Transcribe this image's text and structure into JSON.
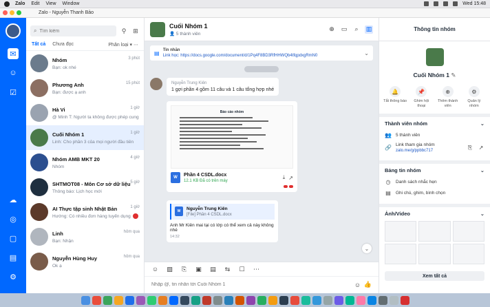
{
  "menubar": {
    "items": [
      "Zalo",
      "Edit",
      "View",
      "Window"
    ],
    "clock": "Wed 15:48"
  },
  "window": {
    "title": "Zalo - Nguyễn Thanh Bảo"
  },
  "conversation_list": {
    "search_placeholder": "Tìm kiếm",
    "tabs": [
      "Tất cả",
      "Chưa đọc"
    ],
    "filter_label": "Phân loại",
    "items": [
      {
        "name": "Nhóm",
        "preview": "Bạn: ok nhé",
        "time": "3 phút",
        "avatar_color": "#6b7b8c"
      },
      {
        "name": "Phương Anh",
        "preview": "Bạn: được ạ anh",
        "time": "15 phút",
        "avatar_color": "#8c6f62"
      },
      {
        "name": "Hà Vi",
        "preview": "@ Minh T: Người ta không được phép cung cấp",
        "time": "1 giờ",
        "avatar_color": "#9aa3b0"
      },
      {
        "name": "Cuối Nhóm 1",
        "preview": "Linh: Cho phần 3 của mọi người đầu tiên",
        "time": "1 giờ",
        "avatar_color": "#4a7a4a",
        "selected": true
      },
      {
        "name": "Nhóm AMB MKT 20",
        "preview": "Nhóm",
        "time": "4 giờ",
        "avatar_color": "#2c4f8f"
      },
      {
        "name": "SHTMOT08 - Môn Cơ sở dữ liệu",
        "preview": "Thông báo: Lịch học mới",
        "time": "5 giờ",
        "avatar_color": "#1f2f3f"
      },
      {
        "name": "AI Thực tập sinh Nhật Bản",
        "preview": "Hướng: Có nhiều đơn hàng tuyển dụng",
        "time": "1 giờ",
        "avatar_color": "#5c3a2a",
        "badge": true
      },
      {
        "name": "Linh",
        "preview": "Bạn: Nhận",
        "time": "hôm qua",
        "avatar_color": "#b0b6be"
      },
      {
        "name": "Nguyễn Hùng Huy",
        "preview": "Ok ạ",
        "time": "hôm qua",
        "avatar_color": "#7a5c4a"
      }
    ]
  },
  "chat": {
    "group_name": "Cuối Nhóm 1",
    "member_count": "5 thành viên",
    "pinned_title": "Tin nhắn",
    "pinned_link": "Link học: https://docs.google.com/document/d/1Pq4F8BD3RfHHWQb4tfqpdxgRmN0",
    "message_sender": "Nguyễn Trung Kiên",
    "message_text": "1 gợi phần 4 gồm 11 câu và 1 câu tổng hợp nhé",
    "doc_title": "Báo cáo nhóm",
    "doc_file_name": "Phần 4 CSDL.docx",
    "doc_file_size": "12.1 KB  Đã có trên máy",
    "reply_quote_name": "Nguyễn Trung Kiên",
    "reply_quote_file": "[File] Phần 4 CSDL.docx",
    "reply_text": "Anh Mr Kiên mai tại có lớp có thể xem cả này không nhé",
    "reply_time": "14:32",
    "composer_placeholder": "Nhập @, tin nhắn tới Cuối Nhóm 1"
  },
  "info_panel": {
    "title": "Thông tin nhóm",
    "group_name": "Cuối Nhóm 1",
    "actions": [
      {
        "label": "Tắt thông báo",
        "icon": "bell-icon"
      },
      {
        "label": "Ghim hội thoại",
        "icon": "pin-icon"
      },
      {
        "label": "Thêm thành viên",
        "icon": "add-user-icon"
      },
      {
        "label": "Quản lý nhóm",
        "icon": "gear-icon"
      }
    ],
    "members_section": "Thành viên nhóm",
    "members_count": "5 thành viên",
    "invite_link_label": "Link tham gia nhóm",
    "invite_link": "zalo.me/g/ppbbc717",
    "board_section": "Bảng tin nhóm",
    "board_items": [
      "Danh sách nhắc hẹn",
      "Ghi chú, ghim, bình chọn"
    ],
    "media_section": "Ảnh/Video",
    "view_all": "Xem tất cả"
  },
  "colors": {
    "accent": "#0068ff",
    "badge": "#e02f2f"
  }
}
